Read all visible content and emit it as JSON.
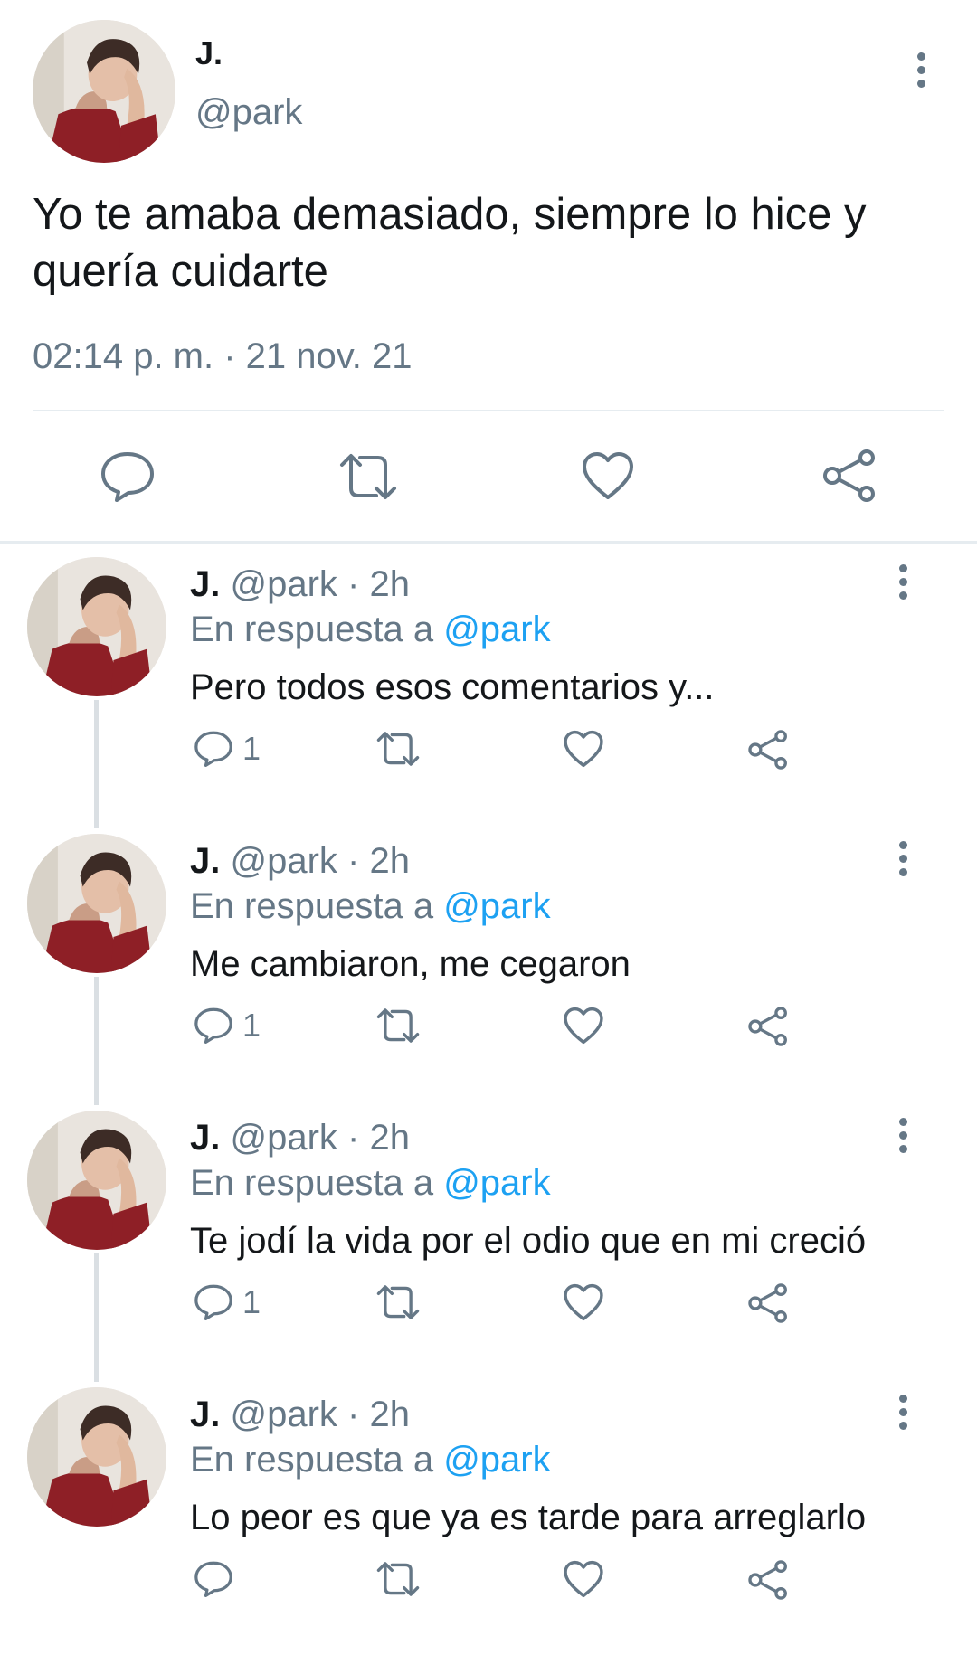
{
  "colors": {
    "accent": "#1da1f2",
    "muted": "#657786",
    "text": "#14171a",
    "divider": "#e6ecf0"
  },
  "main_tweet": {
    "name": "J.",
    "handle": "@park",
    "text": "Yo te amaba demasiado, siempre lo hice y quería cuidarte",
    "timestamp": "02:14 p. m. · 21 nov. 21",
    "actions": [
      "reply-icon",
      "retweet-icon",
      "like-icon",
      "share-icon"
    ]
  },
  "replies": [
    {
      "name": "J.",
      "meta": "@park · 2h",
      "reply_prefix": "En respuesta a ",
      "reply_to": "@park",
      "text": "Pero todos esos comentarios y...",
      "reply_count": "1"
    },
    {
      "name": "J.",
      "meta": "@park · 2h",
      "reply_prefix": "En respuesta a ",
      "reply_to": "@park",
      "text": "Me cambiaron, me cegaron",
      "reply_count": "1"
    },
    {
      "name": "J.",
      "meta": "@park · 2h",
      "reply_prefix": "En respuesta a ",
      "reply_to": "@park",
      "text": "Te jodí la vida por el odio que en mi creció",
      "reply_count": "1"
    },
    {
      "name": "J.",
      "meta": "@park · 2h",
      "reply_prefix": "En respuesta a ",
      "reply_to": "@park",
      "text": "Lo peor es que ya es tarde para arreglarlo",
      "reply_count": ""
    }
  ]
}
